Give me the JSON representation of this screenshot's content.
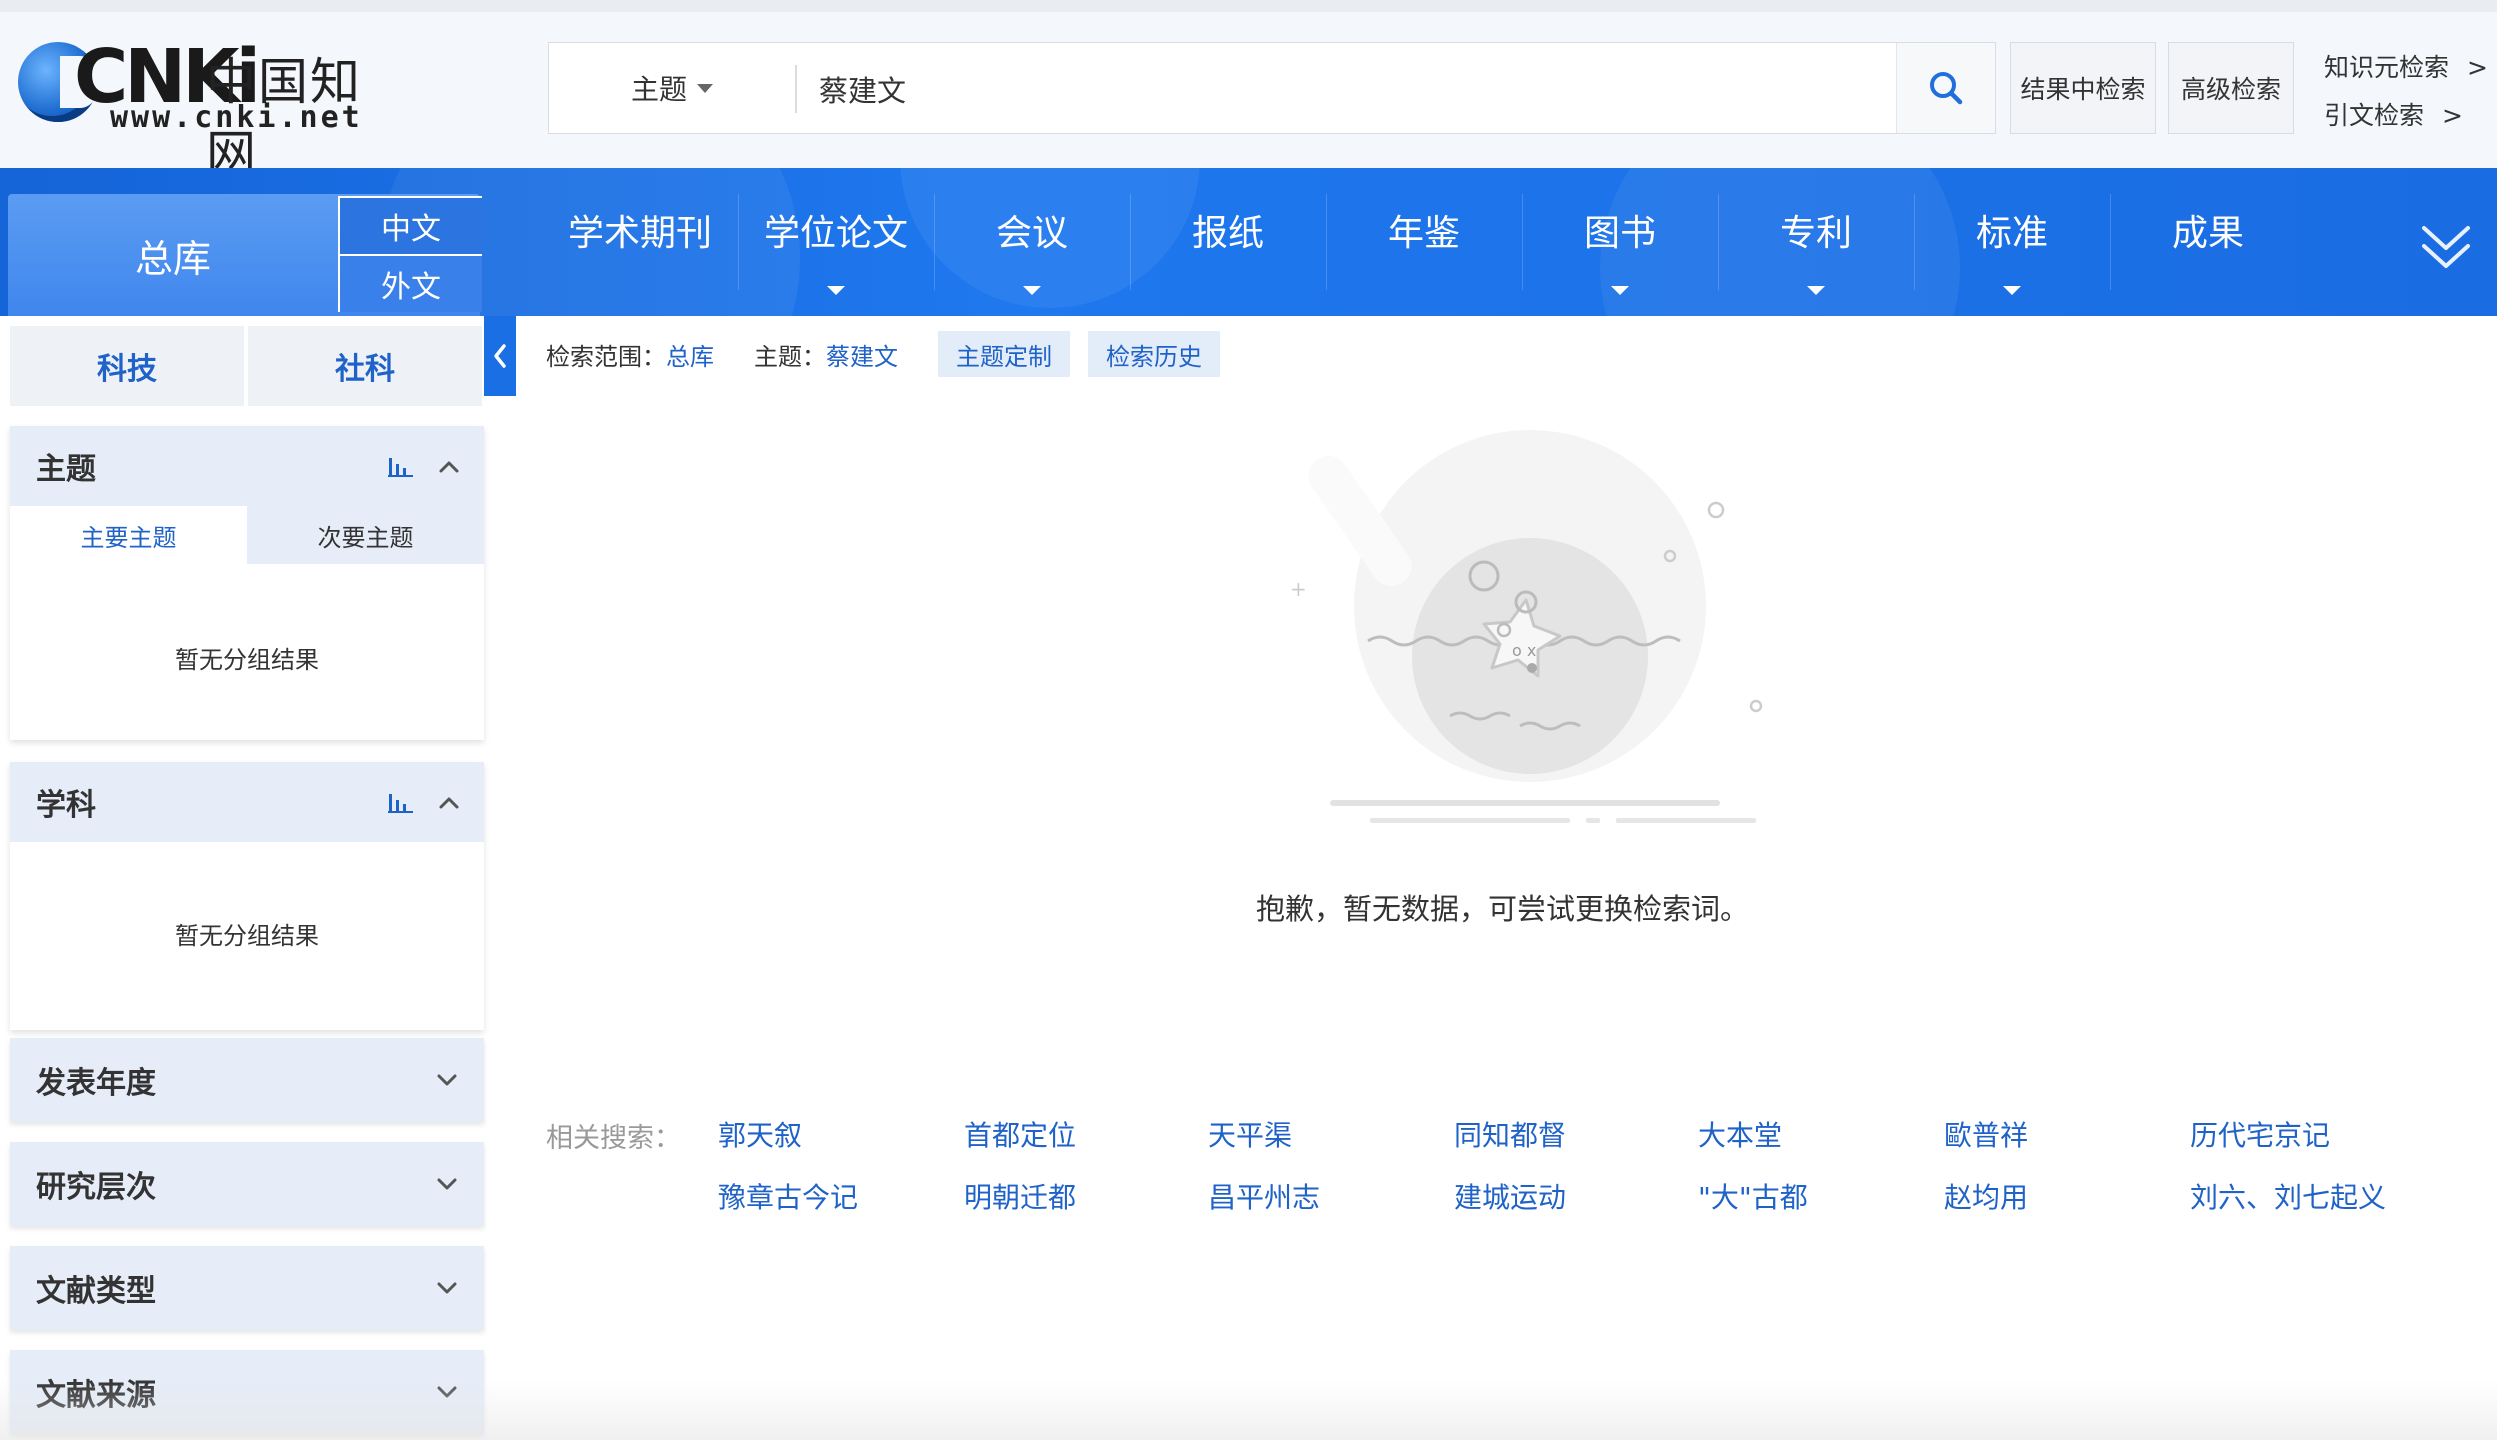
{
  "header": {
    "logo": {
      "brand": "CNKi",
      "brand_cn": "中国知网",
      "site": "www.cnki.net"
    },
    "search": {
      "type_label": "主题",
      "query": "蔡建文"
    },
    "buttons": {
      "in_results": "结果中检索",
      "advanced": "高级检索"
    },
    "links": {
      "knowledge": "知识元检索",
      "citation": "引文检索",
      "arrow": ">"
    }
  },
  "nav": {
    "total": "总库",
    "lang_cn": "中文",
    "lang_en": "外文",
    "items": [
      {
        "label": "学术期刊",
        "dropdown": false
      },
      {
        "label": "学位论文",
        "dropdown": true
      },
      {
        "label": "会议",
        "dropdown": true
      },
      {
        "label": "报纸",
        "dropdown": false
      },
      {
        "label": "年鉴",
        "dropdown": false
      },
      {
        "label": "图书",
        "dropdown": true
      },
      {
        "label": "专利",
        "dropdown": true
      },
      {
        "label": "标准",
        "dropdown": true
      },
      {
        "label": "成果",
        "dropdown": false
      }
    ]
  },
  "sidebar": {
    "tabs": {
      "keji": "科技",
      "sheke": "社科"
    },
    "topic": {
      "title": "主题",
      "sub_main": "主要主题",
      "sub_secondary": "次要主题",
      "empty": "暂无分组结果"
    },
    "subject": {
      "title": "学科",
      "empty": "暂无分组结果"
    },
    "folds": {
      "year": "发表年度",
      "level": "研究层次",
      "type": "文献类型",
      "source": "文献来源"
    }
  },
  "main": {
    "crumbs": {
      "scope_label": "检索范围：",
      "scope_value": "总库",
      "topic_label": "主题：",
      "topic_value": "蔡建文",
      "btn_custom": "主题定制",
      "btn_history": "检索历史"
    },
    "empty_message": "抱歉，暂无数据，可尝试更换检索词。",
    "related": {
      "label": "相关搜索：",
      "row1": [
        "郭天叙",
        "首都定位",
        "天平渠",
        "同知都督",
        "大本堂",
        "歐普祥",
        "历代宅京记"
      ],
      "row2": [
        "豫章古今记",
        "明朝迁都",
        "昌平州志",
        "建城运动",
        "\"大\"古都",
        "赵均用",
        "刘六、刘七起义"
      ]
    }
  },
  "colors": {
    "primary": "#1b6fe4",
    "link": "#1f62c8",
    "panel_head": "#e6edf8"
  }
}
